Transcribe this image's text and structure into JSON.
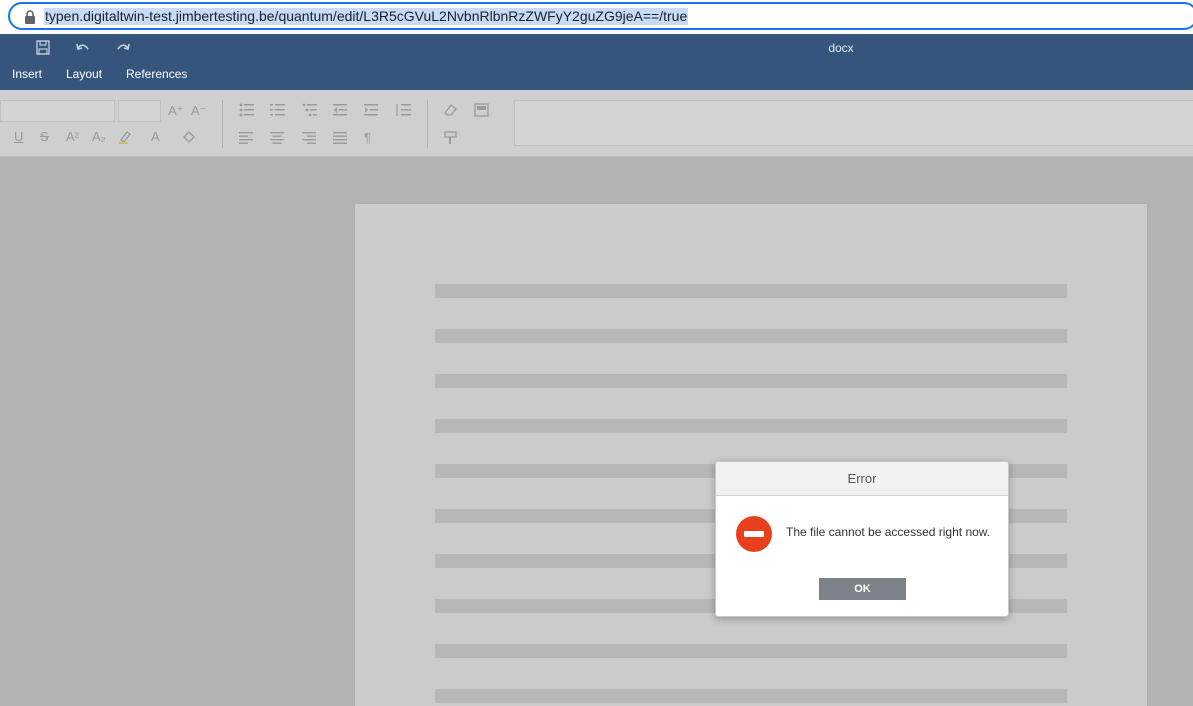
{
  "address_bar": {
    "url": "typen.digitaltwin-test.jimbertesting.be/quantum/edit/L3R5cGVuL2NvbnRlbnRzZWFyY2guZG9jeA==/true"
  },
  "header": {
    "title": "docx",
    "quick_access": [
      "save-icon",
      "undo-icon",
      "redo-icon"
    ],
    "tabs": [
      "Insert",
      "Layout",
      "References"
    ],
    "bg_color": "#35557c"
  },
  "toolbar": {
    "superscript_icon": "A²",
    "subscript_icon": "A₂",
    "font_color_icon": "A",
    "grow_font_icon": "A⁺",
    "shrink_font_icon": "A⁻",
    "paragraph_icon": "¶",
    "underline_icon": "U",
    "strikethrough_icon": "S"
  },
  "dialog": {
    "title": "Error",
    "message": "The file cannot be accessed right now.",
    "ok_label": "OK",
    "icon": "error-icon",
    "icon_color": "#e8401d"
  }
}
